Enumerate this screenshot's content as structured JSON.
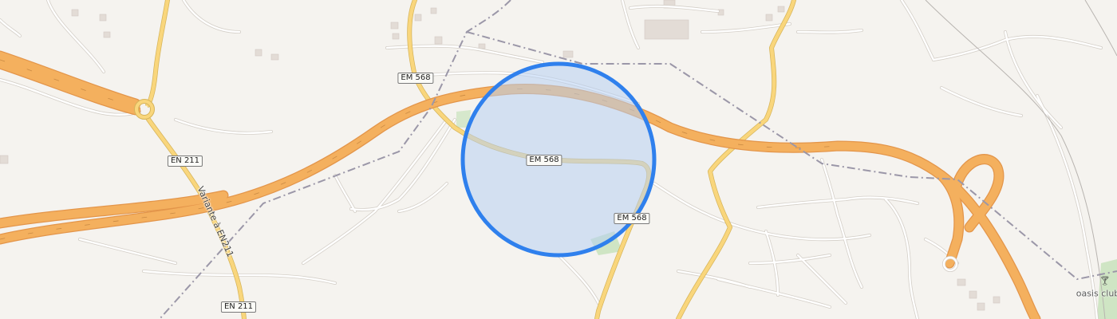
{
  "map": {
    "road_labels": [
      "EM 568",
      "EM 568",
      "EM 568",
      "EN 211",
      "EN 211"
    ],
    "street_name": "Variante à EN211",
    "poi": {
      "name": "oasis club",
      "icon": "cocktail-glass-icon"
    },
    "colors": {
      "background": "#f5f3ef",
      "motorway": "#f4b05e",
      "secondary_road": "#f9d67c",
      "minor_road": "#ffffff",
      "boundary": "#9b97a8",
      "radius_fill": "#b6cff3",
      "radius_stroke": "#2f80ed",
      "green_area": "#cfe5c4"
    }
  }
}
